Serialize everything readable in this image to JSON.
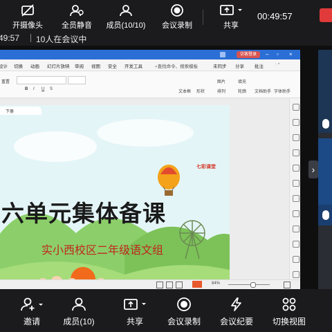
{
  "top_toolbar": {
    "camera_label": "开摄像头",
    "mute_all_label": "全员静音",
    "members_label": "成员(10/10)",
    "record_label": "会议录制",
    "share_label": "共享",
    "clock": "00:49:57"
  },
  "meeting_info": {
    "duration": "49:57",
    "participants": "10人在会议中"
  },
  "ppt": {
    "sign_button": "访客登录",
    "menu": [
      "设计",
      "切换",
      "动画",
      "幻灯片放映",
      "审阅",
      "视图",
      "安全",
      "开发工具",
      "查找命令、搜索模板",
      "未同步",
      "分享",
      "批注"
    ],
    "ribbon": {
      "reset_label": "重置",
      "bold": "B",
      "italic": "I",
      "underline": "U",
      "strike": "S",
      "textbox": "文本框",
      "shape": "形状",
      "arrange": "排列",
      "picture": "图片",
      "fill": "填充",
      "outline": "轮廓",
      "doc_helper": "文档助手",
      "font_helper": "字体助手"
    },
    "slide_tab": "下册",
    "slide": {
      "title": "六单元集体备课",
      "subtitle": "实小西校区二年级语文组",
      "brand": "七彩课堂"
    },
    "status_zoom": "84%"
  },
  "bottom_toolbar": {
    "invite_label": "邀请",
    "members_label": "成员(10)",
    "share_label": "共享",
    "record_label": "会议录制",
    "minutes_label": "会议纪要",
    "switch_view_label": "切换视图"
  },
  "colors": {
    "toolbar_bg": "#1b1b1d",
    "wps_blue": "#2b6fd6",
    "title_red": "#c0261d",
    "record_red": "#e03a3a"
  }
}
